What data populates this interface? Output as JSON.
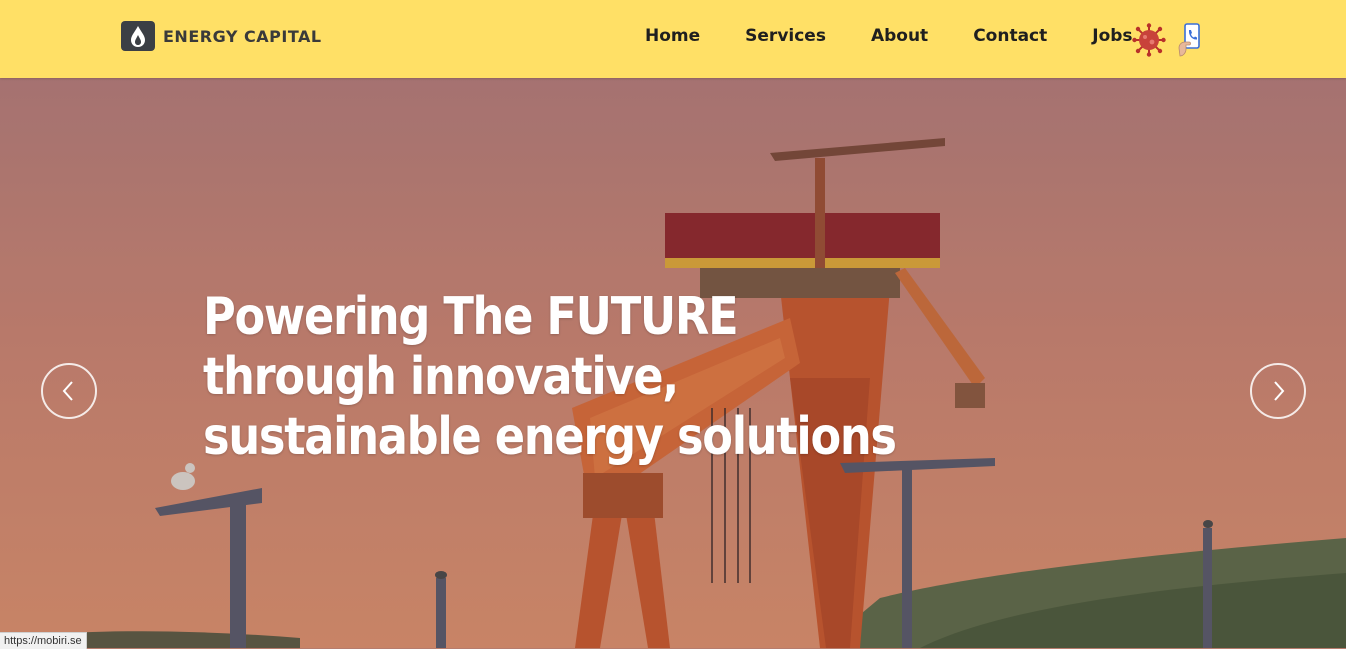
{
  "brand": {
    "name": "ENERGY CAPITAL",
    "icon": "flame-drop-icon"
  },
  "nav": {
    "items": [
      {
        "label": "Home"
      },
      {
        "label": "Services"
      },
      {
        "label": "About"
      },
      {
        "label": "Contact"
      },
      {
        "label": "Jobs"
      }
    ],
    "icons": [
      "virus-icon",
      "phone-hand-icon"
    ]
  },
  "hero": {
    "headline": [
      "Powering The FUTURE",
      "through innovative,",
      "sustainable energy solutions"
    ],
    "prev_icon": "chevron-left-icon",
    "next_icon": "chevron-right-icon"
  },
  "status_bar": {
    "url": "https://mobiri.se"
  },
  "colors": {
    "topbar": "#ffe066",
    "text_dark": "#1f1f1f",
    "hero_text": "#ffffff"
  }
}
